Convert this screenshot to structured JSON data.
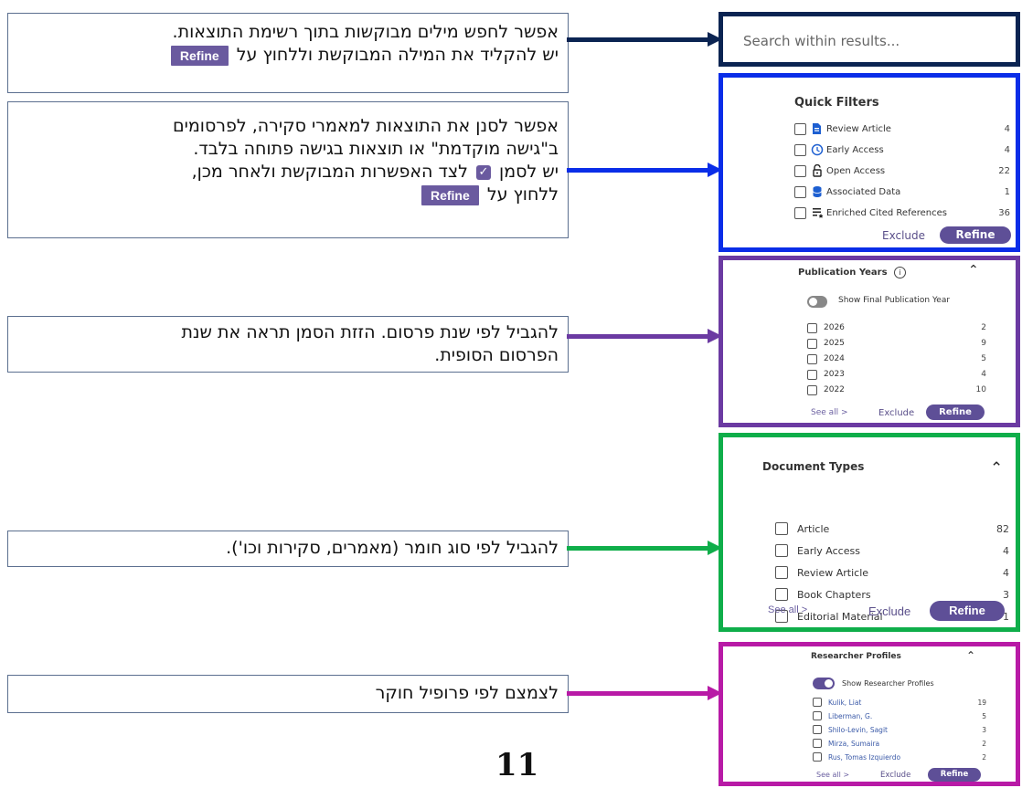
{
  "notes": {
    "search": {
      "line1": "אפשר לחפש מילים מבוקשות בתוך רשימת התוצאות.",
      "line2_prefix": "יש להקליד את המילה המבוקשת וללחוץ על",
      "refine_chip": "Refine"
    },
    "quick_filters": {
      "line1": "אפשר לסנן את התוצאות למאמרי סקירה, לפרסומים",
      "line2": "ב\"גישה מוקדמת\" או תוצאות בגישה פתוחה בלבד.",
      "line3_prefix": "יש לסמן",
      "line3_suffix": "לצד האפשרות המבוקשת ולאחר מכן,",
      "line4_prefix": "ללחוץ על",
      "refine_chip": "Refine"
    },
    "years": {
      "line1": "להגביל לפי שנת פרסום. הזזת הסמן תראה את שנת",
      "line2": "הפרסום הסופית."
    },
    "doc_types": {
      "line1": "להגביל לפי סוג חומר (מאמרים, סקירות וכו')."
    },
    "researcher": {
      "line1": "לצמצם לפי פרופיל חוקר"
    }
  },
  "search_panel": {
    "placeholder": "Search within results..."
  },
  "quick_filters": {
    "title": "Quick Filters",
    "items": [
      {
        "label": "Review Article",
        "count": "4",
        "icon": "document-icon"
      },
      {
        "label": "Early Access",
        "count": "4",
        "icon": "clock-icon"
      },
      {
        "label": "Open Access",
        "count": "22",
        "icon": "open-lock-icon"
      },
      {
        "label": "Associated Data",
        "count": "1",
        "icon": "database-icon"
      },
      {
        "label": "Enriched Cited References",
        "count": "36",
        "icon": "enriched-list-icon"
      }
    ],
    "exclude": "Exclude",
    "refine": "Refine"
  },
  "publication_years": {
    "title": "Publication Years",
    "toggle_label": "Show Final Publication Year",
    "toggle_on": false,
    "items": [
      {
        "label": "2026",
        "count": "2"
      },
      {
        "label": "2025",
        "count": "9"
      },
      {
        "label": "2024",
        "count": "5"
      },
      {
        "label": "2023",
        "count": "4"
      },
      {
        "label": "2022",
        "count": "10"
      }
    ],
    "see_all": "See all >",
    "exclude": "Exclude",
    "refine": "Refine"
  },
  "document_types": {
    "title": "Document Types",
    "items": [
      {
        "label": "Article",
        "count": "82"
      },
      {
        "label": "Early Access",
        "count": "4"
      },
      {
        "label": "Review Article",
        "count": "4"
      },
      {
        "label": "Book Chapters",
        "count": "3"
      },
      {
        "label": "Editorial Material",
        "count": "1"
      }
    ],
    "see_all": "See all >",
    "exclude": "Exclude",
    "refine": "Refine"
  },
  "researcher_profiles": {
    "title": "Researcher Profiles",
    "toggle_label": "Show Researcher Profiles",
    "toggle_on": true,
    "items": [
      {
        "label": "Kulik, Liat",
        "count": "19"
      },
      {
        "label": "Liberman, G.",
        "count": "5"
      },
      {
        "label": "Shilo-Levin, Sagit",
        "count": "3"
      },
      {
        "label": "Mirza, Sumaira",
        "count": "2"
      },
      {
        "label": "Rus, Tomas Izquierdo",
        "count": "2"
      }
    ],
    "see_all": "See all >",
    "exclude": "Exclude",
    "refine": "Refine"
  },
  "page_number": "11",
  "colors": {
    "search": "#0b2452",
    "quick_filters": "#0a2de8",
    "years": "#6b3aa2",
    "doc_types": "#0fae4a",
    "researcher": "#b81aa6",
    "refine": "#5e4f97"
  }
}
